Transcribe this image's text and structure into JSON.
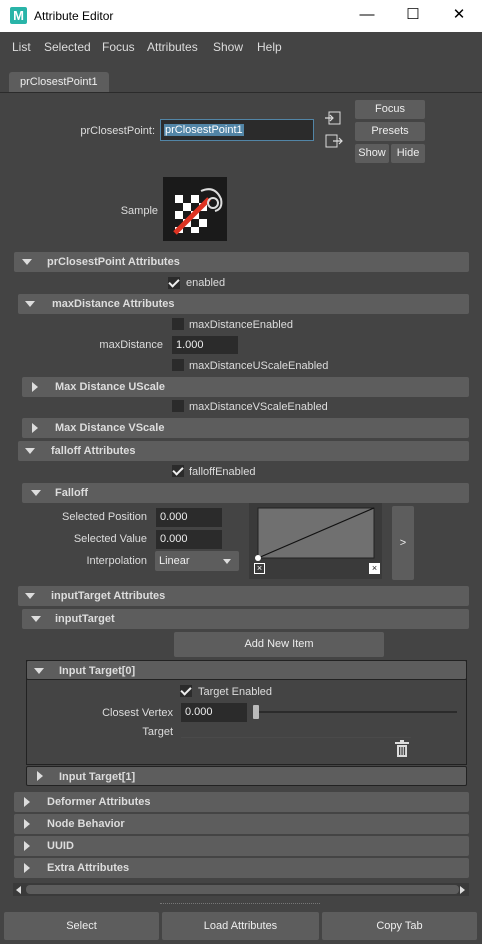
{
  "window": {
    "title": "Attribute Editor",
    "logo_letter": "M"
  },
  "menu": [
    "List",
    "Selected",
    "Focus",
    "Attributes",
    "Show",
    "Help"
  ],
  "tab": "prClosestPoint1",
  "node": {
    "label": "prClosestPoint:",
    "value": "prClosestPoint1"
  },
  "buttons": {
    "focus": "Focus",
    "presets": "Presets",
    "show": "Show",
    "hide": "Hide"
  },
  "sample_label": "Sample",
  "sections": {
    "main": "prClosestPoint Attributes",
    "maxdist": "maxDistance Attributes",
    "uscale": "Max Distance UScale",
    "vscale": "Max Distance VScale",
    "falloff": "falloff Attributes",
    "falloff_sub": "Falloff",
    "inputtarget": "inputTarget Attributes",
    "inputtarget_sub": "inputTarget",
    "it0": "Input Target[0]",
    "it1": "Input Target[1]",
    "deformer": "Deformer Attributes",
    "nodebehavior": "Node Behavior",
    "uuid": "UUID",
    "extra": "Extra Attributes"
  },
  "attrs": {
    "enabled": {
      "label": "enabled",
      "checked": true
    },
    "maxDistanceEnabled": {
      "label": "maxDistanceEnabled",
      "checked": false
    },
    "maxDistance": {
      "label": "maxDistance",
      "value": "1.000"
    },
    "maxDistanceUScaleEnabled": {
      "label": "maxDistanceUScaleEnabled",
      "checked": false
    },
    "maxDistanceVScaleEnabled": {
      "label": "maxDistanceVScaleEnabled",
      "checked": false
    },
    "falloffEnabled": {
      "label": "falloffEnabled",
      "checked": true
    },
    "selectedPosition": {
      "label": "Selected Position",
      "value": "0.000"
    },
    "selectedValue": {
      "label": "Selected Value",
      "value": "0.000"
    },
    "interpolation": {
      "label": "Interpolation",
      "value": "Linear"
    },
    "ramp_expand": ">",
    "add_new_item": "Add New Item",
    "targetEnabled": {
      "label": "Target Enabled",
      "checked": true
    },
    "closestVertex": {
      "label": "Closest Vertex",
      "value": "0.000"
    },
    "target": {
      "label": "Target"
    }
  },
  "bottom": {
    "select": "Select",
    "load": "Load Attributes",
    "copy": "Copy Tab"
  },
  "colors": {
    "bg": "#444444",
    "frame": "#5d5d5d",
    "field": "#2b2b2b",
    "highlight": "#5285a6"
  }
}
